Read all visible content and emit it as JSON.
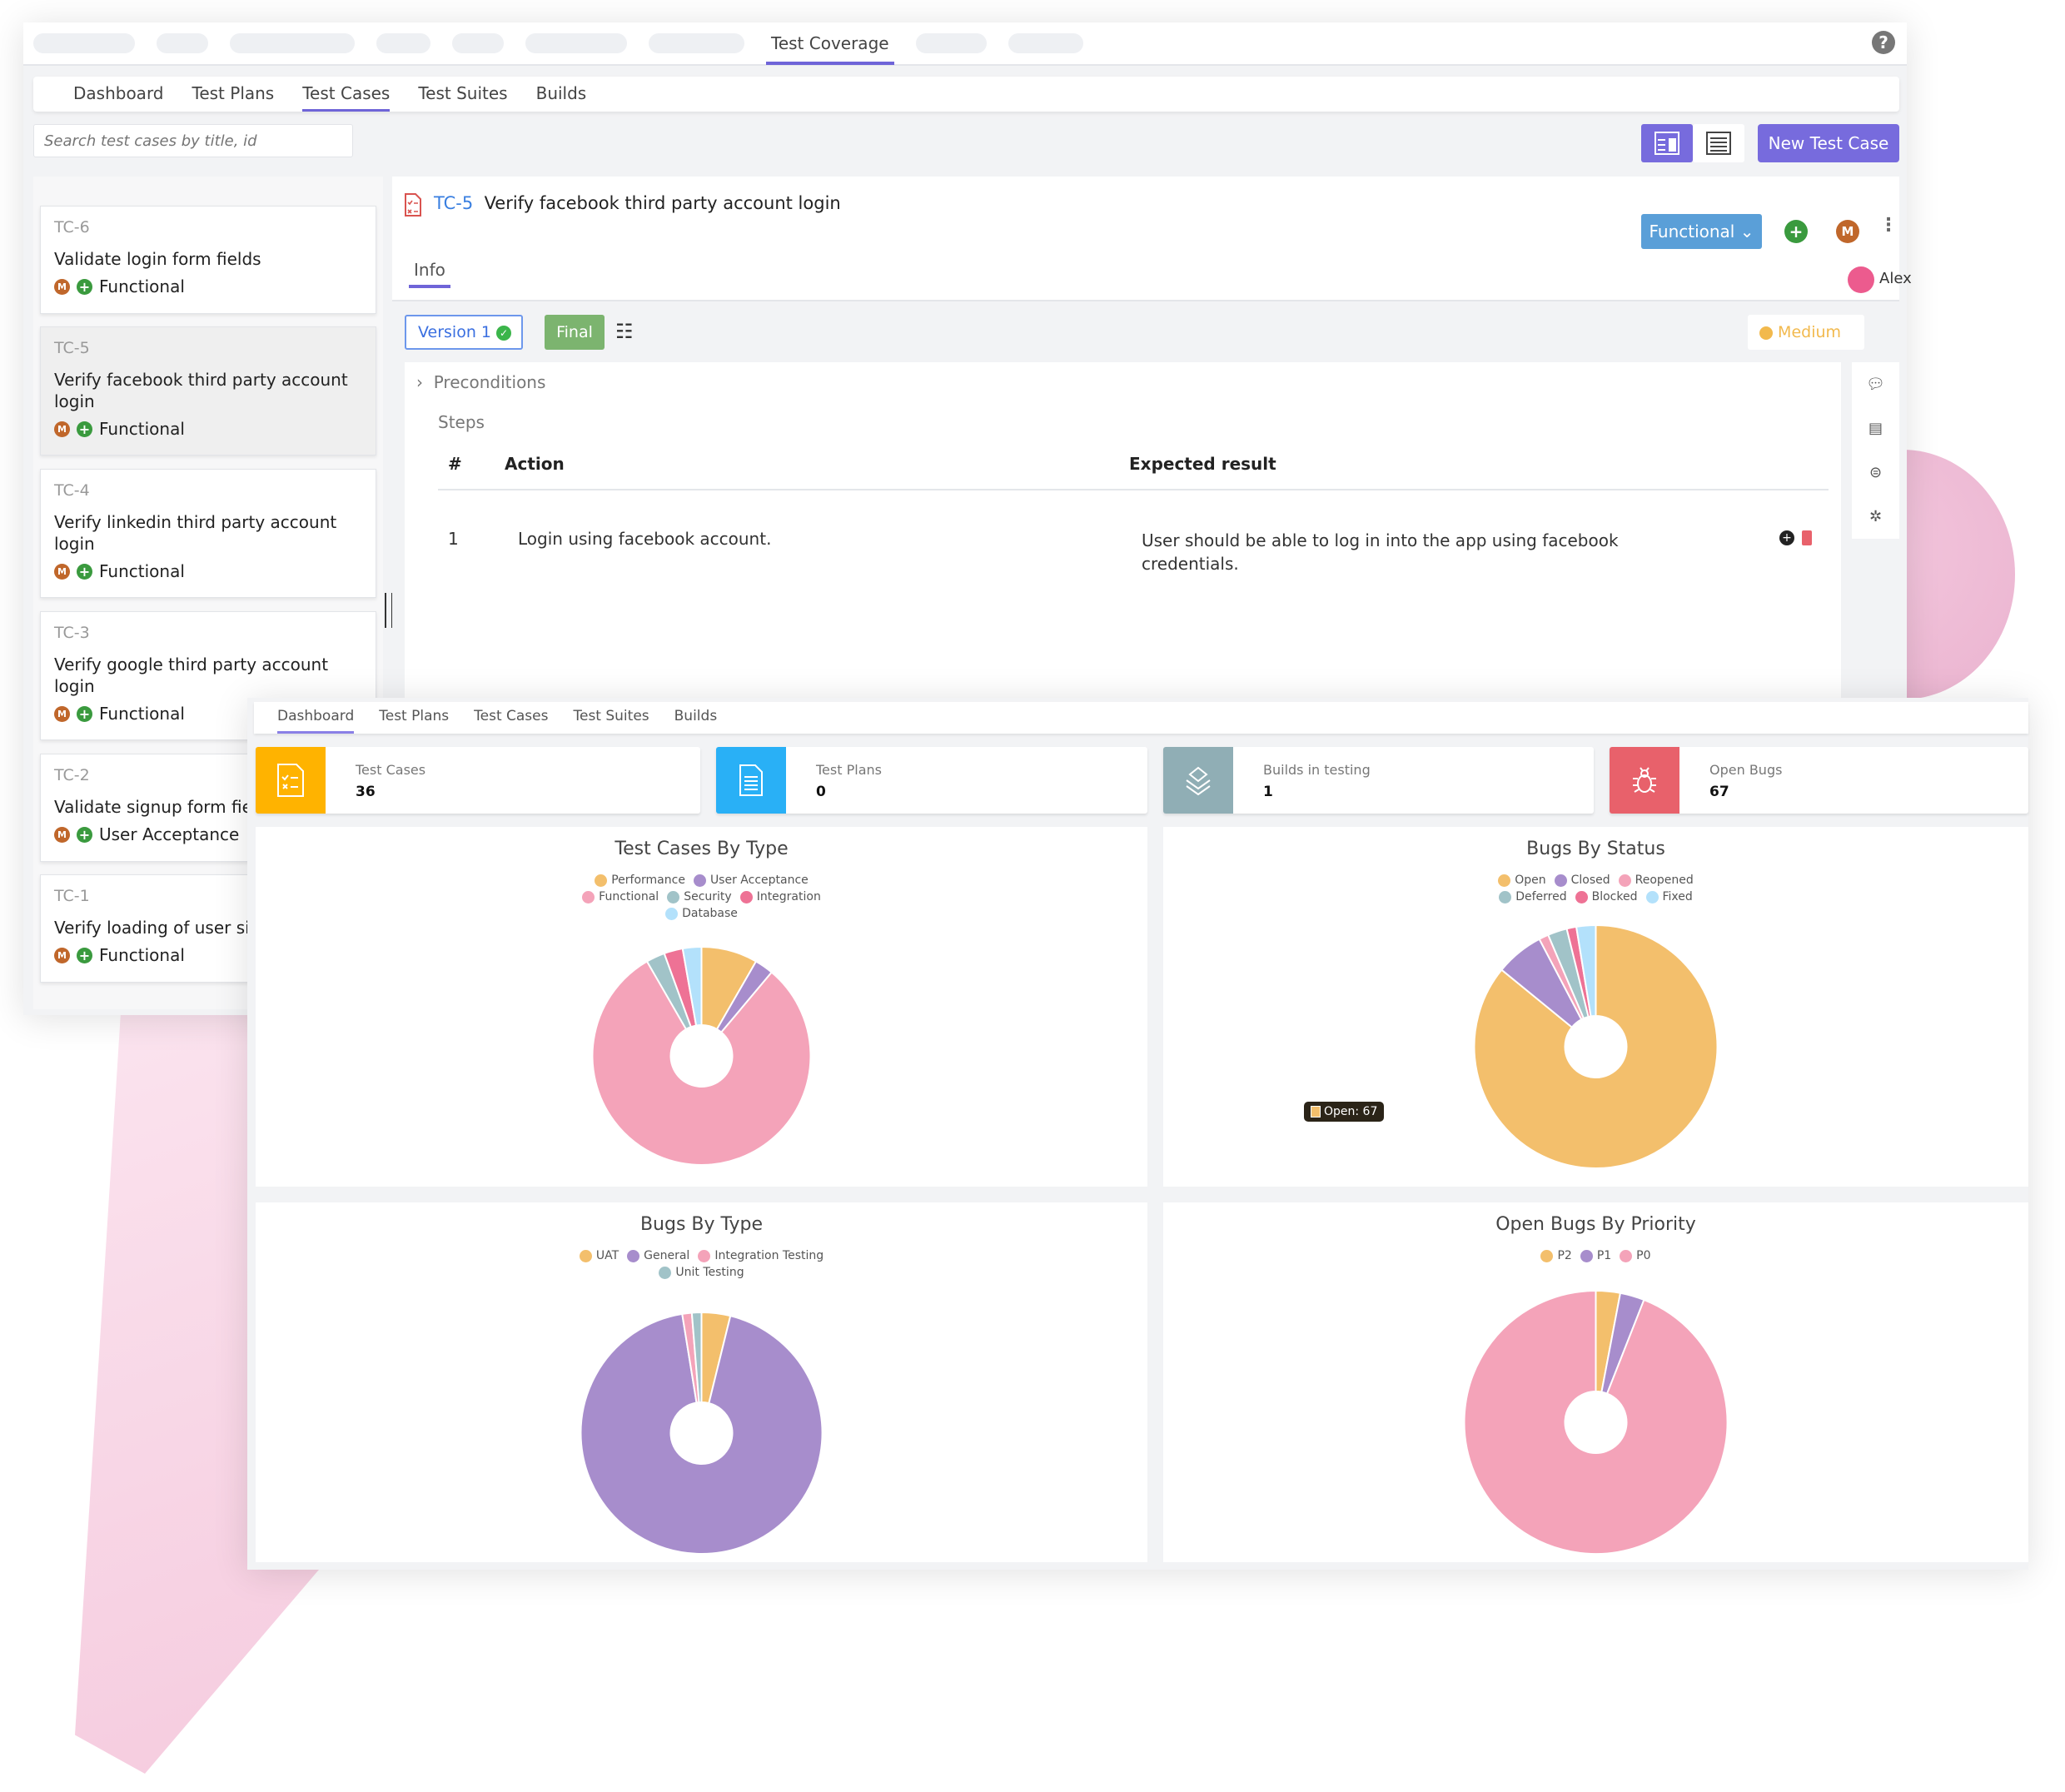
{
  "colors": {
    "accent": "#6f64d8",
    "functional": "#5a9fd8",
    "final": "#7cb46f",
    "medium": "#f2b94d"
  },
  "topnav": {
    "active_tab": "Test Coverage"
  },
  "subnav": {
    "tabs": [
      "Dashboard",
      "Test Plans",
      "Test Cases",
      "Test Suites",
      "Builds"
    ],
    "active": "Test Cases"
  },
  "search": {
    "placeholder": "Search test cases by title, id"
  },
  "toolbar": {
    "new_label": "New Test Case"
  },
  "test_cases": [
    {
      "id": "TC-6",
      "title": "Validate login form fields",
      "type": "Functional"
    },
    {
      "id": "TC-5",
      "title": "Verify facebook third party account login",
      "type": "Functional"
    },
    {
      "id": "TC-4",
      "title": "Verify linkedin third party account login",
      "type": "Functional"
    },
    {
      "id": "TC-3",
      "title": "Verify google third party account login",
      "type": "Functional"
    },
    {
      "id": "TC-2",
      "title": "Validate signup form fields",
      "type": "User Acceptance"
    },
    {
      "id": "TC-1",
      "title": "Verify loading of user signup",
      "type": "Functional"
    }
  ],
  "badges": {
    "m": "M"
  },
  "detail": {
    "id": "TC-5",
    "title": "Verify facebook third party account login",
    "type": "Functional",
    "tab": "Info",
    "assignee": "Alex",
    "version": "Version 1",
    "status": "Final",
    "priority": "Medium",
    "preconditions": "Preconditions",
    "steps_label": "Steps",
    "columns": [
      "#",
      "Action",
      "Expected result"
    ],
    "steps": [
      {
        "n": "1",
        "action": "Login using facebook account.",
        "expected": "User should be able to log in into the app using facebook credentials."
      }
    ]
  },
  "dashboard": {
    "tabs": [
      "Dashboard",
      "Test Plans",
      "Test Cases",
      "Test Suites",
      "Builds"
    ],
    "active": "Dashboard",
    "stats": [
      {
        "label": "Test Cases",
        "value": "36",
        "color": "#ffb300"
      },
      {
        "label": "Test Plans",
        "value": "0",
        "color": "#29b0f6"
      },
      {
        "label": "Builds in testing",
        "value": "1",
        "color": "#90aeb5"
      },
      {
        "label": "Open Bugs",
        "value": "67",
        "color": "#e8616b"
      }
    ],
    "tooltip": "Open: 67"
  },
  "chart_data": [
    {
      "type": "pie",
      "title": "Test Cases By Type",
      "labels": [
        "Performance",
        "User Acceptance",
        "Functional",
        "Security",
        "Integration",
        "Database"
      ],
      "values": [
        3,
        1,
        29,
        1,
        1,
        1
      ],
      "colors": [
        "#f3bf6c",
        "#a78dcc",
        "#f4a3b9",
        "#a1c3c8",
        "#ee7295",
        "#b3e1fb"
      ]
    },
    {
      "type": "pie",
      "title": "Bugs By Status",
      "labels": [
        "Open",
        "Closed",
        "Reopened",
        "Deferred",
        "Blocked",
        "Fixed"
      ],
      "values": [
        67,
        5,
        1,
        2,
        1,
        2
      ],
      "colors": [
        "#f3bf6c",
        "#a78dcc",
        "#f4a3b9",
        "#a1c3c8",
        "#ee7295",
        "#b3e1fb"
      ]
    },
    {
      "type": "pie",
      "title": "Bugs By Type",
      "labels": [
        "UAT",
        "General",
        "Integration Testing",
        "Unit Testing"
      ],
      "values": [
        3,
        73,
        1,
        1
      ],
      "colors": [
        "#f3bf6c",
        "#a78dcc",
        "#f4a3b9",
        "#a1c3c8"
      ]
    },
    {
      "type": "pie",
      "title": "Open Bugs By Priority",
      "labels": [
        "P2",
        "P1",
        "P0"
      ],
      "values": [
        2,
        2,
        63
      ],
      "colors": [
        "#f3bf6c",
        "#a78dcc",
        "#f4a3b9"
      ]
    }
  ]
}
